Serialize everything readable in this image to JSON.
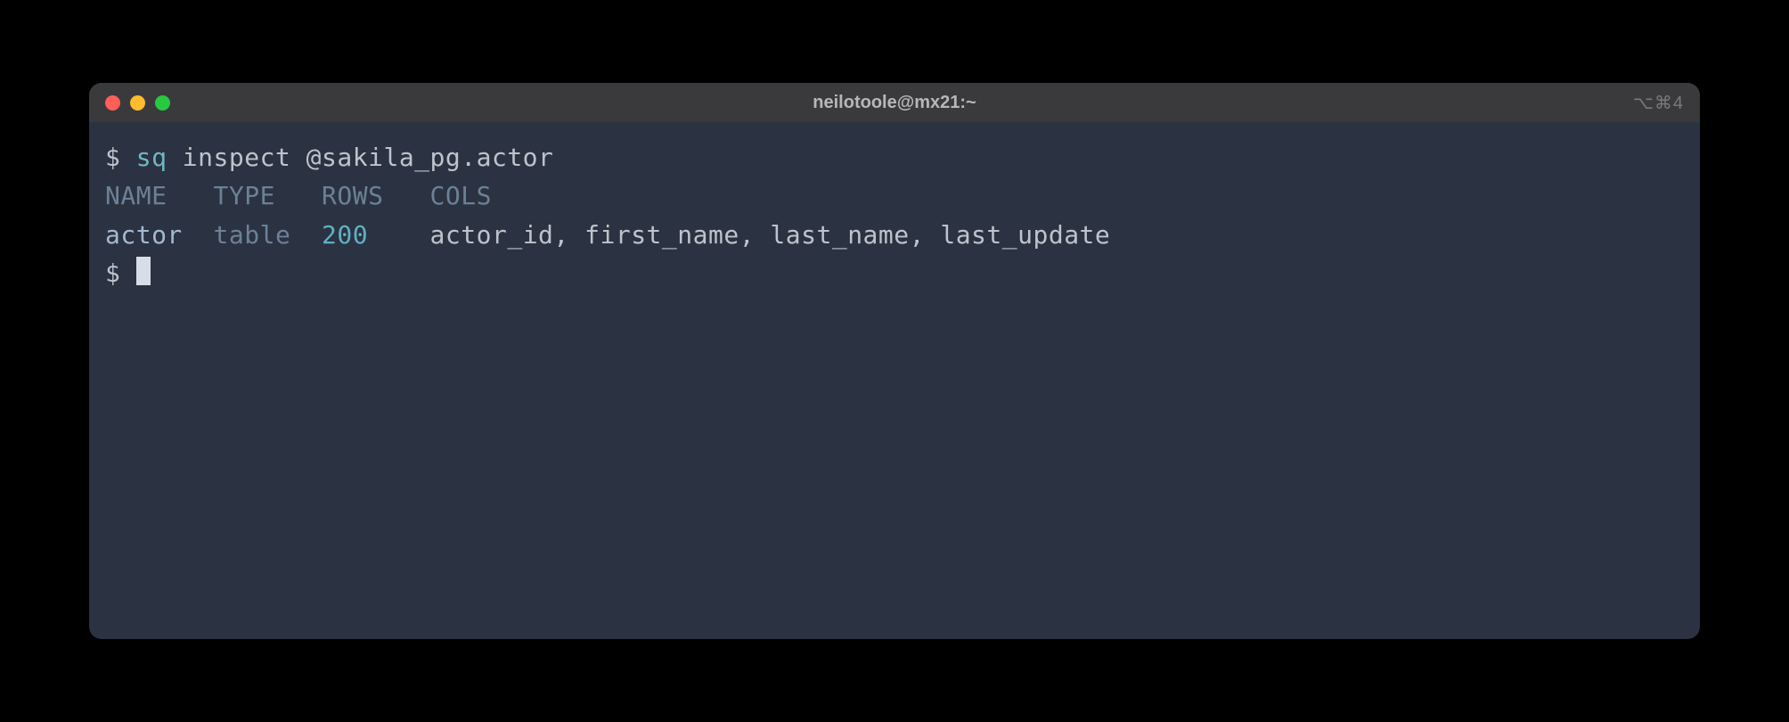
{
  "window": {
    "title": "neilotoole@mx21:~",
    "shortcut_hint": "⌥⌘4"
  },
  "prompt": "$",
  "command": {
    "exe": "sq",
    "sub": "inspect",
    "arg": "@sakila_pg.actor"
  },
  "output": {
    "headers": {
      "name": "NAME",
      "type": "TYPE",
      "rows": "ROWS",
      "cols": "COLS"
    },
    "row": {
      "name": "actor",
      "type": "table",
      "rows": "200",
      "cols": "actor_id, first_name, last_name, last_update"
    }
  }
}
